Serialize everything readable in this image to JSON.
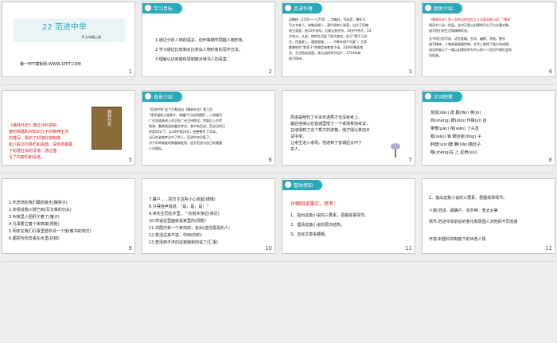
{
  "slides": [
    {
      "n": "1",
      "title": "22 范进中举",
      "sub": "R·九年级上册",
      "footer": "第一PPT模板网-WWW.1PPT.COM"
    },
    {
      "n": "2",
      "hdr": "学习目标",
      "lines": [
        "1.通过分析人物的语言、动作等细节把握人物形象。",
        "2.学习通过比较和对比突出人物形象的写作方法。",
        "3.理解认识封建科举制度对读书人的毒害。"
      ]
    },
    {
      "n": "3",
      "hdr": "走进作者",
      "lines": [
        "吴敬梓（1701——1754），字敏轩，号粒民，晚年又",
        "号文木老人，安徽全椒人，清代讽刺小说家。出生于官僚",
        "地主家庭，他13岁丧母，后随父到任所，20岁中秀才，23",
        "岁丧父。从此，他的生活起了很大变化，由于“素不习治",
        "生，性复豪上，遇贫即施，……不数年而产尽矣”。大家",
        "都拿他作“败家子”的典型来教育子弟。33岁时移居南",
        "京，生活愈加贫困。其后卖掉家中田产，1754年病",
        "逝于扬州。"
      ]
    },
    {
      "n": "4",
      "hdr": "相关介绍",
      "lines": [
        "《儒林外史》是一部杰出的现实主义长篇讽刺小说。“儒林”",
        "指读书人这一阶层。全书正是以封建知识分子为主要对象，",
        "描写他们的生活和精神状态。",
        "全书用白话写成，语言准确、生动、幽默、洗练。细节",
        "描写精神、人物刻画细腻传神，艺术上取得了极大的成就。",
        "成功的展示了一幅以封建科举为中心的十八世纪中国社会的",
        "风俗画。"
      ]
    },
    {
      "n": "5",
      "lines": [
        "《儒林外史》通过对科举制",
        "度的揭露和对知识分子的精神生活",
        "的描写，揭示了封建科举制度",
        "和八股文的腐朽和黑暗，深刻地暴露",
        "了封建社会的没落。通过描",
        "写了的腐朽和没落。"
      ],
      "book": "儒林外史"
    },
    {
      "n": "6",
      "hdr": "背景介绍",
      "lines": [
        "“范进中举”这个片断选自《儒林外史》第三回",
        "“周学道校士拔真才，胡屠户行凶闹捷报”，小说描写",
        "广东学道周进上任后在广州主持院试，考取后上京考",
        "南海、番禺两县的童生考试，其中有范进。范进当时已",
        "经是54岁了，从20岁到54岁，他整整考了35年。",
        "当日在省城考试中了举人，范进中举后疯了。",
        "对于科举制度的揭露和批判，因为范进与自己的遭遇",
        "十分相似。"
      ]
    },
    {
      "n": "7",
      "lines": [
        "周进是明代了许多年连秀才也没有考上。",
        "最后他得以在省城里借了一个考场参加考试，",
        "在他得到了这个秀才的资格，他才得以参加乡",
        "试中举。",
        "让考生进入考场，范进到了省城后又中了",
        "举人。"
      ]
    },
    {
      "n": "8",
      "hdr": "字词积累",
      "lines": [
        "荒诞(dàn)  蹭  翻(fān)  箦(jū)",
        "商(shāng)  蹲(dūn)  作揖(yī)  自",
        "带攀(pān)  绾(wǎn)  了头发",
        "粗(xiǎo)  锁  细丝锭(dìng)  子",
        "醉醺(xūn)醺  腆(tiǎn)着肚子",
        "睁(zhēng)在  上  星宿(xiù)"
      ]
    },
    {
      "n": "9",
      "lines": [
        "1.你怎地在我们跟前装大(摆架子)",
        "2.宗师说我火候已到(写文章的功夫)",
        "3.叫家里人把肝子着了(猪子)",
        "4.凡事要立着个体统来(规矩)",
        "5.明年在我们行事里替你寻一个馆(教书的地方)",
        "6.都把与你去丢在水里(扔掉)"
      ]
    },
    {
      "n": "10",
      "lines": [
        "7.屠户……把方才这些小心收起(谨慎)",
        "8.只得连声说道：“是，是，是！”",
        "9.世先生同在乡里，一向有失亲近(亲近)",
        "10.你说这里面就是家里的(规矩)",
        "11.邻居内有一个卖鸡的，走出(送信报喜的人)",
        "12.若活过来不进，你到(你的)",
        "13.若活到不济的这婆娘和你说了(汇报)"
      ]
    },
    {
      "n": "11",
      "hdr": "整体感知",
      "lines": [
        "仔细阅读课文，思考：",
        "1、指出这篇小说的三要素，把握故事情节。",
        "2、理清这篇小说的层次结构。",
        "3、还有文章事梗概。"
      ]
    },
    {
      "n": "12",
      "lines": [
        "1、指出这篇小说的三要素，把握故事情节。",
        "人物:范进、胡屠户、张乡绅、老太太等",
        "情节:范进中举前后的变化和周围人对他的不同态度",
        "环境:封建科举制度下的世态人情"
      ]
    }
  ]
}
